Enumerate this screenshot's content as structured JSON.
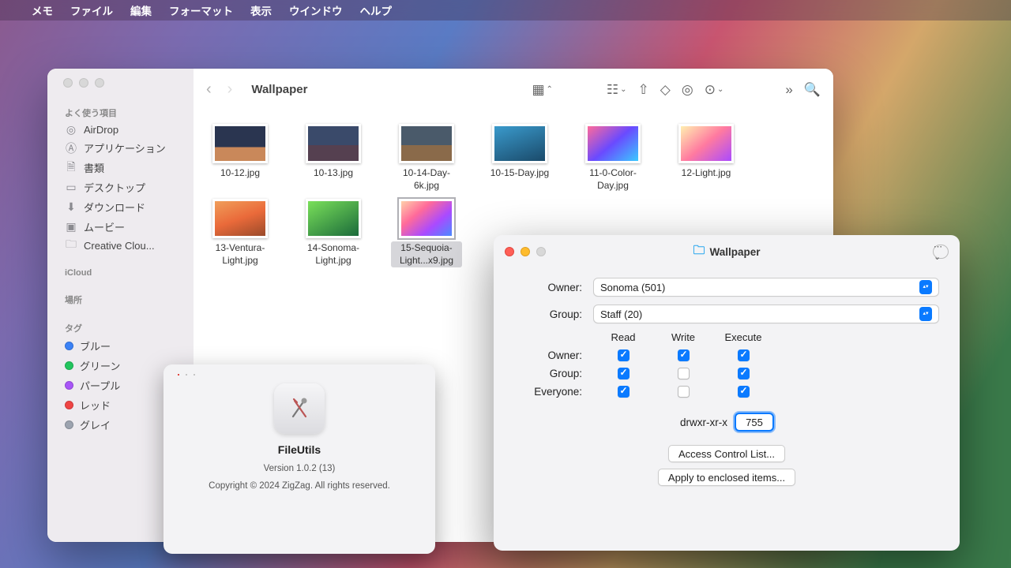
{
  "menubar": {
    "app": "メモ",
    "items": [
      "ファイル",
      "編集",
      "フォーマット",
      "表示",
      "ウインドウ",
      "ヘルプ"
    ]
  },
  "finder": {
    "title": "Wallpaper",
    "sidebar": {
      "favorites_heading": "よく使う項目",
      "favorites": [
        "AirDrop",
        "アプリケーション",
        "書類",
        "デスクトップ",
        "ダウンロード",
        "ムービー",
        "Creative Clou..."
      ],
      "icloud_heading": "iCloud",
      "locations_heading": "場所",
      "tags_heading": "タグ",
      "tags": [
        "ブルー",
        "グリーン",
        "パープル",
        "レッド",
        "グレイ"
      ]
    },
    "files": [
      "10-12.jpg",
      "10-13.jpg",
      "10-14-Day-6k.jpg",
      "10-15-Day.jpg",
      "11-0-Color-Day.jpg",
      "12-Light.jpg",
      "13-Ventura-Light.jpg",
      "14-Sonoma-Light.jpg",
      "15-Sequoia-Light...x9.jpg"
    ]
  },
  "about": {
    "name": "FileUtils",
    "version": "Version 1.0.2 (13)",
    "copyright": "Copyright © 2024 ZigZag. All rights reserved."
  },
  "perm": {
    "title": "Wallpaper",
    "owner_label": "Owner:",
    "owner_value": "Sonoma (501)",
    "group_label": "Group:",
    "group_value": "Staff (20)",
    "cols": [
      "Read",
      "Write",
      "Execute"
    ],
    "rows": [
      "Owner:",
      "Group:",
      "Everyone:"
    ],
    "checks": {
      "owner": {
        "read": true,
        "write": true,
        "execute": true
      },
      "group": {
        "read": true,
        "write": false,
        "execute": true
      },
      "everyone": {
        "read": true,
        "write": false,
        "execute": true
      }
    },
    "mode_string": "drwxr-xr-x",
    "octal": "755",
    "acl_btn": "Access Control List...",
    "apply_btn": "Apply to enclosed items..."
  }
}
